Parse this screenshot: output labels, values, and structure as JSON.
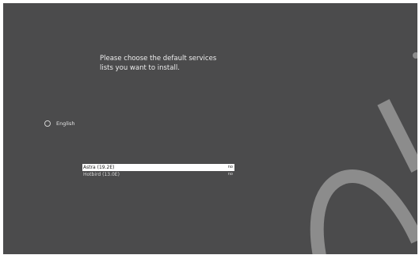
{
  "prompt": {
    "line1": "Please choose the default services",
    "line2": "lists you want to install."
  },
  "language": {
    "label": "English"
  },
  "services": [
    {
      "name": "Astra (19.2E)",
      "value": "no"
    },
    {
      "name": "Hotbird (13.0E)",
      "value": "no"
    }
  ],
  "colors": {
    "background": "#4b4b4c",
    "selection": "#ffffff",
    "text": "#e8e8e8"
  }
}
